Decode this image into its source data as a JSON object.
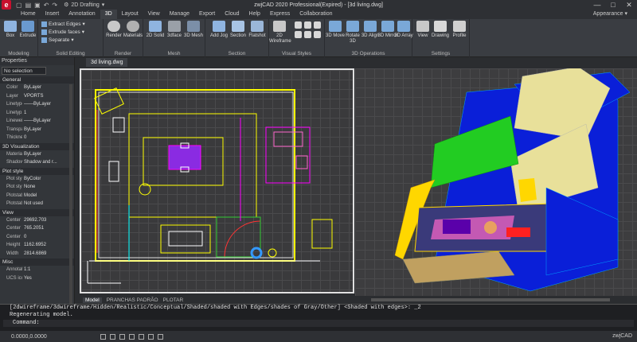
{
  "window": {
    "title": "zwjCAD 2020 Professional(Expired) - [3d living.dwg]",
    "workspace": "2D Drafting",
    "controls": [
      "—",
      "□",
      "✕"
    ]
  },
  "tabs": [
    "Home",
    "Insert",
    "Annotation",
    "3D",
    "Layout",
    "View",
    "Manage",
    "Export",
    "Cloud",
    "Help",
    "Express",
    "Collaboration"
  ],
  "active_tab": "3D",
  "appearance_label": "Appearance",
  "ribbon": {
    "modeling": {
      "label": "Modeling",
      "box": "Box",
      "extrude": "Extrude"
    },
    "solid_editing": {
      "label": "Solid Editing",
      "extract_edges": "Extract Edges",
      "extrude_faces": "Extrude faces",
      "separate": "Separate"
    },
    "render": {
      "label": "Render",
      "render": "Render",
      "materials": "Materials"
    },
    "mesh": {
      "label": "Mesh",
      "solid2d": "2D Solid",
      "face3d": "3dface",
      "mesh3d": "3D Mesh"
    },
    "section": {
      "label": "Section",
      "add_jog": "Add Jog",
      "section": "Section",
      "flatshot": "Flatshot"
    },
    "visual_styles": {
      "label": "Visual Styles",
      "wireframe": "2D Wireframe"
    },
    "operations": {
      "label": "3D Operations",
      "move": "3D Move",
      "rotate": "Rotate 3D",
      "align": "3D Align",
      "mirror": "3D Mirror",
      "array": "3D Array"
    },
    "settings": {
      "label": "Settings",
      "view": "View",
      "drawing": "Drawing",
      "profile": "Profile"
    }
  },
  "properties": {
    "title": "Properties",
    "selection": "No selection",
    "sections": [
      {
        "name": "General",
        "rows": [
          {
            "k": "Color",
            "v": "ByLayer"
          },
          {
            "k": "Layer",
            "v": "VPORTS"
          },
          {
            "k": "Linetype",
            "v": "——ByLayer"
          },
          {
            "k": "Linetyp...",
            "v": "1"
          },
          {
            "k": "Linewei...",
            "v": "——ByLayer"
          },
          {
            "k": "Transpa...",
            "v": "ByLayer"
          },
          {
            "k": "Thickne...",
            "v": "0"
          }
        ]
      },
      {
        "name": "3D Visualization",
        "rows": [
          {
            "k": "Material",
            "v": "ByLayer"
          },
          {
            "k": "Shadow...",
            "v": "Shadow and r..."
          }
        ]
      },
      {
        "name": "Plot style",
        "rows": [
          {
            "k": "Plot style",
            "v": "ByColor"
          },
          {
            "k": "Plot styl...",
            "v": "None"
          },
          {
            "k": "Plotstabl...",
            "v": "Model"
          },
          {
            "k": "Plotstabl...",
            "v": "Not used"
          }
        ]
      },
      {
        "name": "View",
        "rows": [
          {
            "k": "Center X",
            "v": "29692.703"
          },
          {
            "k": "Center Y",
            "v": "765.2051"
          },
          {
            "k": "Center Z",
            "v": "0"
          },
          {
            "k": "Height",
            "v": "1162.6952"
          },
          {
            "k": "Width",
            "v": "2814.6869"
          }
        ]
      },
      {
        "name": "Misc",
        "rows": [
          {
            "k": "Annotati...",
            "v": "1:1"
          },
          {
            "k": "UCS ico...",
            "v": "Yes"
          }
        ]
      }
    ]
  },
  "doc_tab": "3d living.dwg",
  "layout_tabs": [
    "Model",
    "PRANCHAS PADRÃO",
    "PLOTAR"
  ],
  "command": {
    "history": [
      "[2dwireframe/3dwireframe/Hidden/Realistic/Conceptual/Shaded/shaded with Edges/shades of Gray/Other] <Shaded with edges>: _2",
      "Regenerating model."
    ],
    "prompt": "Command:"
  },
  "status": {
    "coordinates": "0.0000,0.0000",
    "brand": "zwjCAD"
  },
  "colors": {
    "accent": "#c8102e",
    "ribbon_bg": "#3a3d42",
    "viewport_bg": "#3a3a3c"
  }
}
